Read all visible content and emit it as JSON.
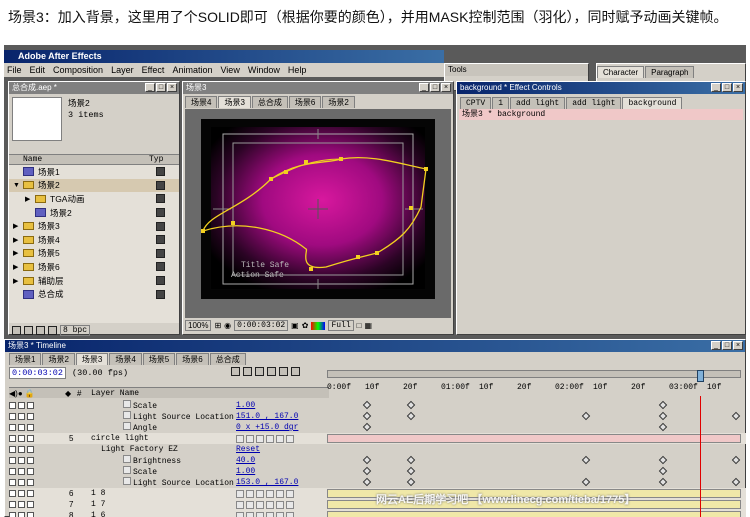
{
  "caption": "场景3：加入背景，这里用了个SOLID即可（根据你要的颜色），并用MASK控制范围（羽化），同时赋予动画关键帧。",
  "app": {
    "title": "Adobe After Effects",
    "menu": [
      "File",
      "Edit",
      "Composition",
      "Layer",
      "Effect",
      "Animation",
      "View",
      "Window",
      "Help"
    ]
  },
  "tools": {
    "title": "Tools"
  },
  "character": {
    "tabs": [
      "Character",
      "Paragraph"
    ]
  },
  "project": {
    "title": "总合成.aep *",
    "selected_name": "场景2",
    "selected_info": "3 items",
    "col_name": "Name",
    "col_type": "Typ",
    "items": [
      {
        "label": "场景1",
        "kind": "comp",
        "indent": 0,
        "tri": ""
      },
      {
        "label": "场景2",
        "kind": "folder",
        "indent": 0,
        "tri": "▼",
        "selected": true
      },
      {
        "label": "TGA动画",
        "kind": "folder",
        "indent": 1,
        "tri": "▶"
      },
      {
        "label": "场景2",
        "kind": "comp",
        "indent": 1,
        "tri": ""
      },
      {
        "label": "场景3",
        "kind": "folder",
        "indent": 0,
        "tri": "▶"
      },
      {
        "label": "场景4",
        "kind": "folder",
        "indent": 0,
        "tri": "▶"
      },
      {
        "label": "场景5",
        "kind": "folder",
        "indent": 0,
        "tri": "▶"
      },
      {
        "label": "场景6",
        "kind": "folder",
        "indent": 0,
        "tri": "▶"
      },
      {
        "label": "辅助层",
        "kind": "folder",
        "indent": 0,
        "tri": "▶"
      },
      {
        "label": "总合成",
        "kind": "comp",
        "indent": 0,
        "tri": ""
      }
    ],
    "bpc": "8 bpc"
  },
  "comp": {
    "title": "场景3",
    "tabs": [
      "场景4",
      "场景3",
      "总合成",
      "场景6",
      "场景2"
    ],
    "active_tab": 1,
    "safe_title": "Title Safe",
    "safe_action": "Action Safe",
    "zoom": "100%",
    "time": "0:00:03:02",
    "res": "Full"
  },
  "effects": {
    "title": "background * Effect Controls",
    "tabs": [
      "CPTV",
      "1",
      "add light",
      "add light",
      "background"
    ],
    "active_tab": 4,
    "row": "场景3 * background"
  },
  "timeline": {
    "title": "场景3 * Timeline",
    "tabs": [
      "场景1",
      "场景2",
      "场景3",
      "场景4",
      "场景5",
      "场景6",
      "总合成"
    ],
    "active_tab": 2,
    "time": "0:00:03:02",
    "fps": "(30.00 fps)",
    "col_layer": "Layer Name",
    "ruler": [
      "0:00f",
      "10f",
      "20f",
      "01:00f",
      "10f",
      "20f",
      "02:00f",
      "10f",
      "20f",
      "03:00f",
      "10f"
    ],
    "rows": [
      {
        "name": "Scale",
        "value": "1.00",
        "type": "prop",
        "indent": 2,
        "keys": [
          0.09,
          0.2,
          0.82
        ]
      },
      {
        "name": "Light Source Location",
        "value": "151.0 , 167.0",
        "type": "prop",
        "indent": 2,
        "keys": [
          0.09,
          0.2,
          0.63,
          0.82,
          1.0
        ]
      },
      {
        "name": "Angle",
        "value": "0 x +15.0 dgr",
        "type": "prop",
        "indent": 2,
        "keys": [
          0.09,
          0.82
        ]
      },
      {
        "num": "5",
        "name": "circle light",
        "type": "layer",
        "indent": 0,
        "bar": "pink"
      },
      {
        "name": "Light Factory EZ",
        "value": "Reset",
        "type": "effect",
        "indent": 1
      },
      {
        "name": "Brightness",
        "value": "40.0",
        "type": "prop",
        "indent": 2,
        "keys": [
          0.09,
          0.2,
          0.63,
          0.82,
          1.0
        ]
      },
      {
        "name": "Scale",
        "value": "1.00",
        "type": "prop",
        "indent": 2,
        "keys": [
          0.09,
          0.2,
          0.82
        ]
      },
      {
        "name": "Light Source Location",
        "value": "153.0 , 167.0",
        "type": "prop",
        "indent": 2,
        "keys": [
          0.09,
          0.2,
          0.63,
          0.82,
          1.0
        ]
      },
      {
        "num": "6",
        "name": "1 8",
        "type": "layer",
        "indent": 0,
        "bar": "yellow"
      },
      {
        "num": "7",
        "name": "1 7",
        "type": "layer",
        "indent": 0,
        "bar": "yellow"
      },
      {
        "num": "8",
        "name": "1 6",
        "type": "layer",
        "indent": 0,
        "bar": "yellow"
      }
    ]
  },
  "watermark": "网云AE后期学习吧 【www.linecg.com/tieba/1775】",
  "colors": {
    "accent": "#08246b",
    "magenta": "#c0108a",
    "mask": "#f2d020",
    "pinkbar": "#f0c8c8",
    "yellowbar": "#f0e8a8"
  }
}
